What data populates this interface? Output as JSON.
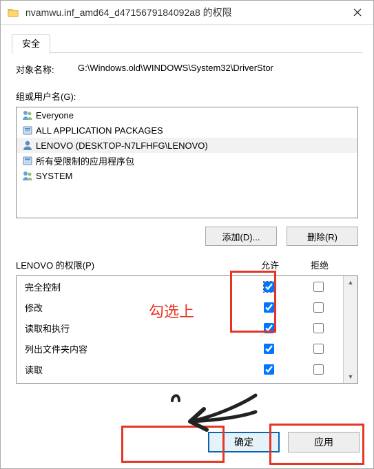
{
  "titlebar": {
    "title": "nvamwu.inf_amd64_d4715679184092a8 的权限"
  },
  "tab": {
    "label": "安全"
  },
  "object": {
    "label": "对象名称:",
    "value": "G:\\Windows.old\\WINDOWS\\System32\\DriverStor"
  },
  "groups": {
    "label": "组或用户名(G):",
    "items": [
      {
        "label": "Everyone",
        "icon": "two-users"
      },
      {
        "label": "ALL APPLICATION PACKAGES",
        "icon": "package"
      },
      {
        "label": "LENOVO (DESKTOP-N7LFHFG\\LENOVO)",
        "icon": "one-user",
        "selected": true
      },
      {
        "label": "所有受限制的应用程序包",
        "icon": "package"
      },
      {
        "label": "SYSTEM",
        "icon": "two-users"
      }
    ]
  },
  "buttons": {
    "add": "添加(D)...",
    "remove": "删除(R)",
    "ok": "确定",
    "apply": "应用"
  },
  "perms": {
    "title": "LENOVO 的权限(P)",
    "allow": "允许",
    "deny": "拒绝",
    "rows": [
      {
        "label": "完全控制",
        "allow": true,
        "deny": false,
        "focused": true
      },
      {
        "label": "修改",
        "allow": true,
        "deny": false
      },
      {
        "label": "读取和执行",
        "allow": true,
        "deny": false
      },
      {
        "label": "列出文件夹内容",
        "allow": true,
        "deny": false
      },
      {
        "label": "读取",
        "allow": true,
        "deny": false
      }
    ]
  },
  "annotation": {
    "text": "勾选上"
  }
}
